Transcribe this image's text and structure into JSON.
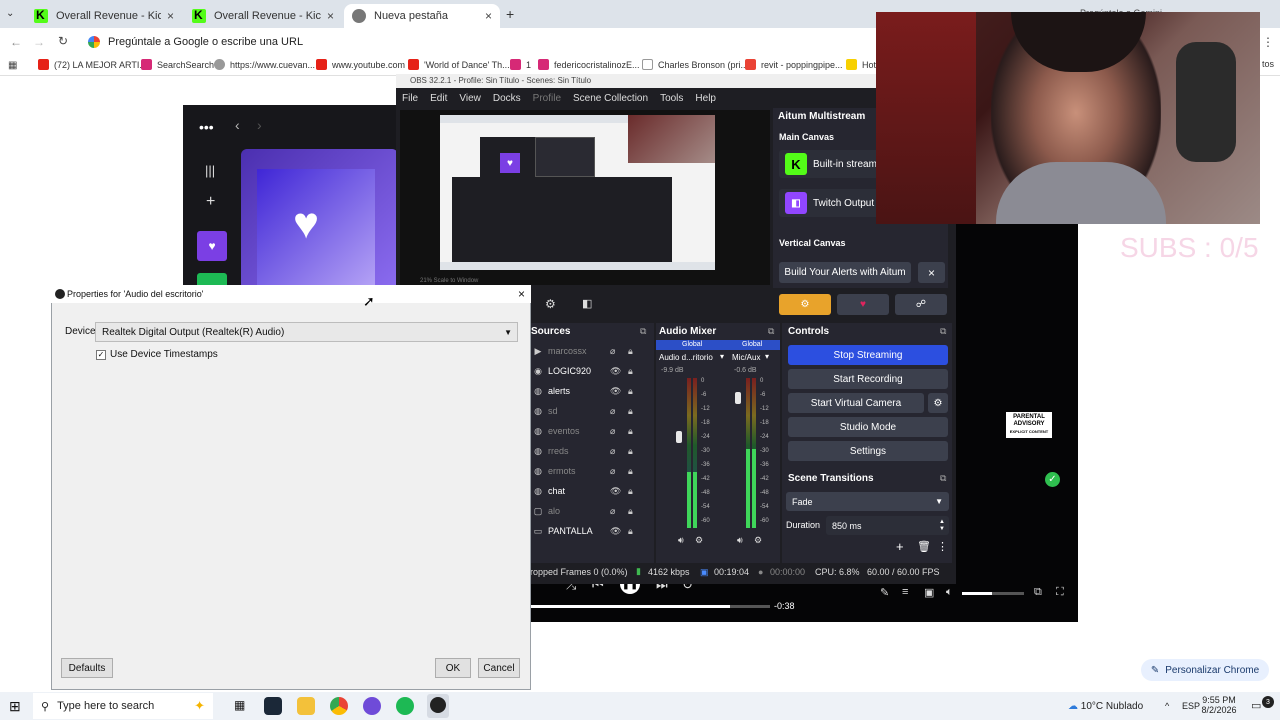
{
  "chrome": {
    "tabs": [
      {
        "title": "Overall Revenue - Kick Dashbo",
        "close": "×"
      },
      {
        "title": "Overall Revenue - Kick Dashbo",
        "close": "×"
      },
      {
        "title": "Nueva pestaña",
        "close": "×"
      }
    ],
    "new_tab": "+",
    "omnibox_placeholder": "Pregúntale a Google o escribe una URL",
    "gemini_hint": "Pregúntale a Gemini",
    "bookmarks": [
      "(72) LA MEJOR ARTI...",
      "SearchSearch",
      "https://www.cuevan...",
      "www.youtube.com",
      "'World of Dance' Th...",
      "1",
      "federicocristalinozE...",
      "Charles Bronson (pri...",
      "revit - poppingpipe...",
      "Hot"
    ],
    "bookmarks_more": "tos",
    "personalize_label": "Personalizar Chrome"
  },
  "kick": {
    "elapsed": "-0:38"
  },
  "obs": {
    "title": "OBS 32.2.1 - Profile: Sin Título - Scenes: Sin Título",
    "menu": [
      "File",
      "Edit",
      "View",
      "Docks",
      "Profile",
      "Scene Collection",
      "Tools",
      "Help"
    ],
    "preview_footer": "21%   Scale to Window",
    "aitum": {
      "title": "Aitum Multistream",
      "main_canvas": "Main Canvas",
      "builtin": "Built-in stream",
      "twitch": "Twitch Output",
      "vertical_canvas": "Vertical Canvas",
      "alerts_btn": "Build Your Alerts with Aitum",
      "alerts_close": "×"
    },
    "sources": {
      "title": "Sources",
      "items": [
        {
          "name": "marcossx",
          "icon": "▶",
          "visible": false
        },
        {
          "name": "LOGIC920",
          "icon": "◉",
          "visible": true
        },
        {
          "name": "alerts",
          "icon": "◍",
          "visible": true
        },
        {
          "name": "sd",
          "icon": "◍",
          "visible": false
        },
        {
          "name": "eventos",
          "icon": "◍",
          "visible": false
        },
        {
          "name": "rreds",
          "icon": "◍",
          "visible": false
        },
        {
          "name": "ermots",
          "icon": "◍",
          "visible": false
        },
        {
          "name": "chat",
          "icon": "◍",
          "visible": true
        },
        {
          "name": "alo",
          "icon": "▢",
          "visible": false
        },
        {
          "name": "PANTALLA",
          "icon": "▭",
          "visible": true
        }
      ]
    },
    "mixer": {
      "title": "Audio Mixer",
      "channels": [
        {
          "badge": "Global",
          "name": "Audio d...ritorio",
          "db": "-9.9 dB",
          "level": 0.62
        },
        {
          "badge": "Global",
          "name": "Mic/Aux",
          "db": "-0.6 dB",
          "level": 0.88
        }
      ],
      "ticks": [
        "0",
        "-6",
        "-12",
        "-18",
        "-24",
        "-30",
        "-36",
        "-42",
        "-48",
        "-54",
        "-60"
      ]
    },
    "controls": {
      "title": "Controls",
      "stop_streaming": "Stop Streaming",
      "start_recording": "Start Recording",
      "start_virtual_camera": "Start Virtual Camera",
      "studio_mode": "Studio Mode",
      "settings": "Settings"
    },
    "transitions": {
      "title": "Scene Transitions",
      "selected": "Fade",
      "duration_label": "Duration",
      "duration_value": "850 ms"
    },
    "status": {
      "dropped": "ropped Frames 0 (0.0%)",
      "bitrate": "4162 kbps",
      "stream_time": "00:19:04",
      "rec_time": "00:00:00",
      "cpu": "CPU: 6.8%",
      "fps": "60.00 / 60.00 FPS"
    }
  },
  "overlay": {
    "subs": "SUBS : 0/5",
    "advisory_line1": "PARENTAL",
    "advisory_line2": "ADVISORY",
    "advisory_line3": "EXPLICIT CONTENT"
  },
  "dialog": {
    "title": "Properties for 'Audio del escritorio'",
    "device_label": "Device",
    "device_value": "Realtek Digital Output (Realtek(R) Audio)",
    "timestamps_label": "Use Device Timestamps",
    "timestamps_checked": true,
    "defaults": "Defaults",
    "ok": "OK",
    "cancel": "Cancel"
  },
  "taskbar": {
    "search_placeholder": "Type here to search",
    "weather": "10°C  Nublado",
    "lang": "ESP",
    "time": "9:55 PM",
    "date": "8/2/2026",
    "notif_count": "3"
  }
}
